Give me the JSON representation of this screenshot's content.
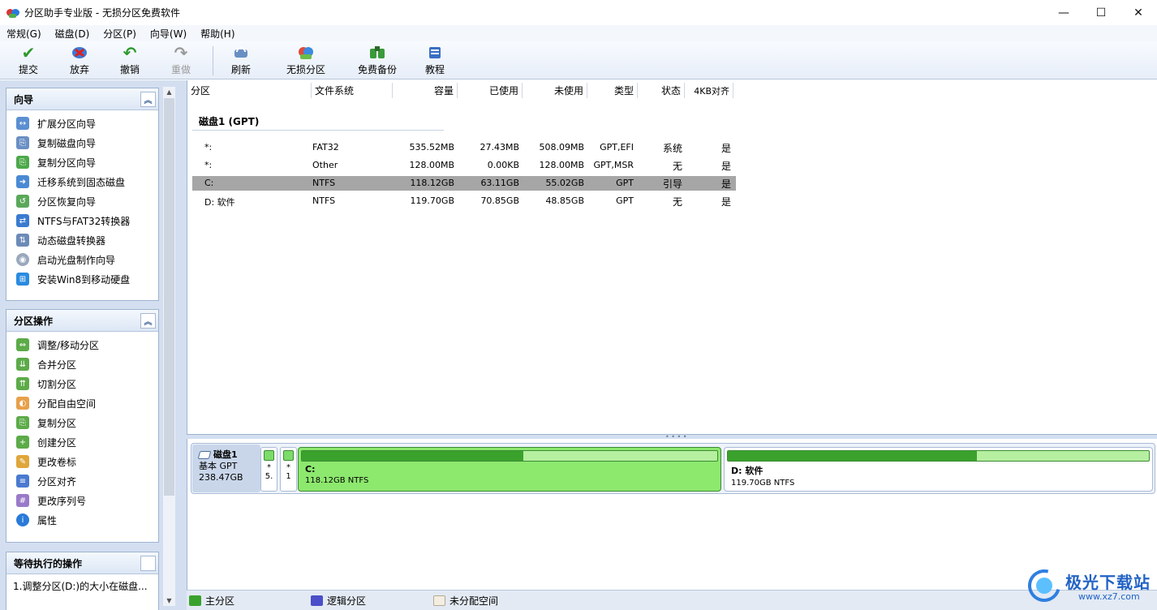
{
  "window": {
    "title": "分区助手专业版 - 无损分区免费软件",
    "minimize": "—",
    "maximize": "☐",
    "close": "✕"
  },
  "menu": [
    "常规(G)",
    "磁盘(D)",
    "分区(P)",
    "向导(W)",
    "帮助(H)"
  ],
  "toolbar": {
    "submit": "提交",
    "discard": "放弃",
    "undo": "撤销",
    "redo": "重做",
    "refresh": "刷新",
    "lossless": "无损分区",
    "backup": "免费备份",
    "tutorial": "教程"
  },
  "wizard_panel": {
    "title": "向导",
    "items": [
      "扩展分区向导",
      "复制磁盘向导",
      "复制分区向导",
      "迁移系统到固态磁盘",
      "分区恢复向导",
      "NTFS与FAT32转换器",
      "动态磁盘转换器",
      "启动光盘制作向导",
      "安装Win8到移动硬盘"
    ]
  },
  "partition_ops_panel": {
    "title": "分区操作",
    "items": [
      "调整/移动分区",
      "合并分区",
      "切割分区",
      "分配自由空间",
      "复制分区",
      "创建分区",
      "更改卷标",
      "分区对齐",
      "更改序列号",
      "属性"
    ]
  },
  "pending_panel": {
    "title": "等待执行的操作",
    "items": [
      "1.调整分区(D:)的大小在磁盘..."
    ]
  },
  "table": {
    "columns": [
      "分区",
      "文件系统",
      "容量",
      "已使用",
      "未使用",
      "类型",
      "状态",
      "4KB对齐"
    ],
    "disk_label": "磁盘1 (GPT)",
    "rows": [
      {
        "partition": "*:",
        "fs": "FAT32",
        "capacity": "535.52MB",
        "used": "27.43MB",
        "unused": "508.09MB",
        "type": "GPT,EFI",
        "status": "系统",
        "align": "是"
      },
      {
        "partition": "*:",
        "fs": "Other",
        "capacity": "128.00MB",
        "used": "0.00KB",
        "unused": "128.00MB",
        "type": "GPT,MSR",
        "status": "无",
        "align": "是"
      },
      {
        "partition": "C:",
        "fs": "NTFS",
        "capacity": "118.12GB",
        "used": "63.11GB",
        "unused": "55.02GB",
        "type": "GPT",
        "status": "引导",
        "align": "是"
      },
      {
        "partition": "D: 软件",
        "fs": "NTFS",
        "capacity": "119.70GB",
        "used": "70.85GB",
        "unused": "48.85GB",
        "type": "GPT",
        "status": "无",
        "align": "是"
      }
    ]
  },
  "diskmap": {
    "disk_name": "磁盘1",
    "disk_type": "基本 GPT",
    "disk_size": "238.47GB",
    "mini1": {
      "l1": "*",
      "l2": "5."
    },
    "mini2": {
      "l1": "*",
      "l2": "1"
    },
    "part_c": {
      "name": "C:",
      "info": "118.12GB NTFS",
      "used_fraction": 0.534
    },
    "part_d": {
      "name": "D: 软件",
      "info": "119.70GB NTFS",
      "used_fraction": 0.592
    }
  },
  "legend": {
    "primary": "主分区",
    "logical": "逻辑分区",
    "unallocated": "未分配空间",
    "colors": {
      "primary": "#3aa22c",
      "logical": "#4b4fc9",
      "unallocated": "#f3ede2"
    }
  },
  "watermark": {
    "name": "极光下载站",
    "url": "www.xz7.com"
  }
}
